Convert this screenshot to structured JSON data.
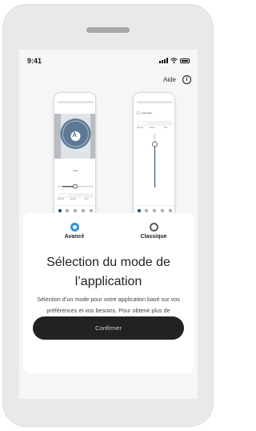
{
  "status_bar": {
    "time": "9:41"
  },
  "header": {
    "help_label": "Aide",
    "info_glyph": "i"
  },
  "previews": {
    "advanced": {
      "letter": "A",
      "tabs": [
        "Normal",
        "Autres",
        "Plus"
      ]
    },
    "classic": {
      "program": "Automatic",
      "tabs": [
        "Normal",
        "Autres",
        "Plus"
      ]
    }
  },
  "options": [
    {
      "label": "Avancé",
      "selected": true
    },
    {
      "label": "Classique",
      "selected": false
    }
  ],
  "modal": {
    "title": "Sélection du mode de l’application",
    "description": "Sélection d’un mode pour votre application basé sur vos préférences et vos besoins. Pour obtenir plus de renseignements, vous pouvez appuyez sur le bouton d’aide dans le coin supérieur droit.",
    "confirm_label": "Confirmer"
  },
  "colors": {
    "accent": "#2d95e0",
    "button": "#222222",
    "device": "#e9e9e9"
  }
}
